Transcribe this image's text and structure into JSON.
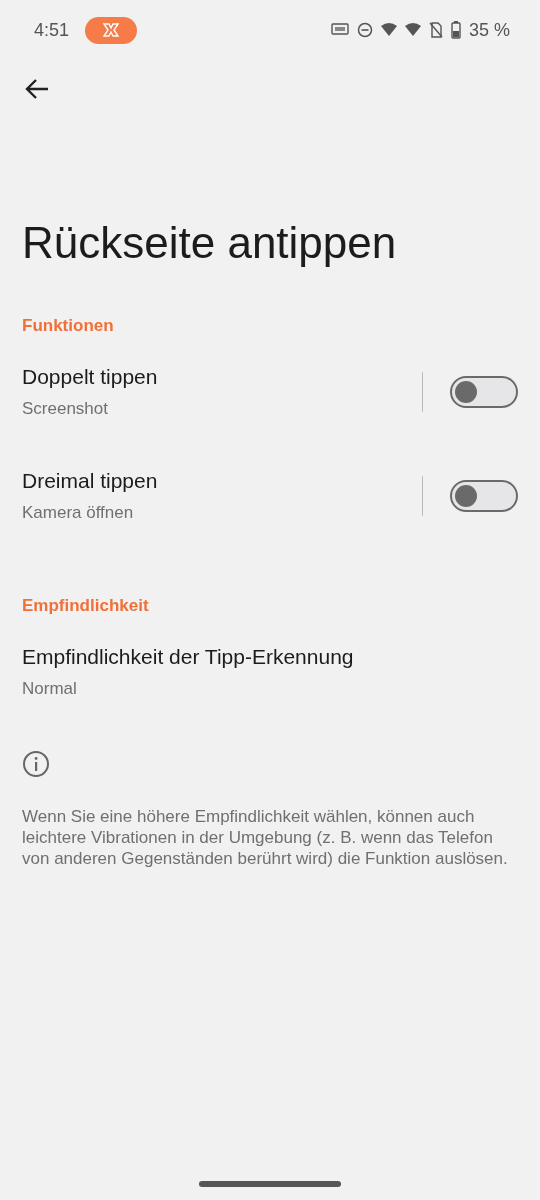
{
  "status_bar": {
    "time": "4:51",
    "battery": "35 %"
  },
  "title": "Rückseite antippen",
  "sections": [
    {
      "header": "Funktionen",
      "items": [
        {
          "kind": "toggle",
          "title": "Doppelt tippen",
          "subtitle": "Screenshot",
          "on": false
        },
        {
          "kind": "toggle",
          "title": "Dreimal tippen",
          "subtitle": "Kamera öffnen",
          "on": false
        }
      ]
    },
    {
      "header": "Empfindlichkeit",
      "items": [
        {
          "kind": "plain",
          "title": "Empfindlichkeit der Tipp-Erkennung",
          "subtitle": "Normal"
        }
      ]
    }
  ],
  "info": "Wenn Sie eine höhere Empfindlichkeit wählen, können auch leichtere Vibrationen in der Umgebung (z. B. wenn das Telefon von anderen Gegenständen berührt wird) die Funktion auslösen."
}
